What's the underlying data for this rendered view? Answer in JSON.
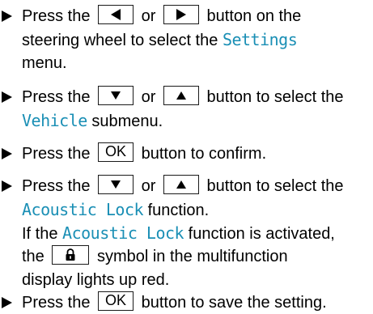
{
  "colors": {
    "text": "#000000",
    "display_text": "#1a8fb5"
  },
  "steps": [
    {
      "lines": [
        {
          "pre": "Press the",
          "key1": "left-arrow",
          "mid": "or",
          "key2": "right-arrow",
          "post": "button on the"
        },
        {
          "text": "steering wheel to select the",
          "display": "Settings"
        },
        {
          "text": "menu."
        }
      ]
    },
    {
      "lines": [
        {
          "pre": "Press the",
          "key1": "down-arrow",
          "mid": "or",
          "key2": "up-arrow",
          "post": "button to select the"
        },
        {
          "display": "Vehicle",
          "text": "submenu."
        }
      ]
    },
    {
      "lines": [
        {
          "pre": "Press the",
          "key": "OK",
          "post": "button to confirm."
        }
      ]
    },
    {
      "lines": [
        {
          "pre": "Press the",
          "key1": "down-arrow",
          "mid": "or",
          "key2": "up-arrow",
          "post": "button to select the"
        },
        {
          "display": "Acoustic Lock",
          "text": "function."
        },
        {
          "pre": "If the",
          "display": "Acoustic Lock",
          "post": "function is activated,"
        },
        {
          "pre": "the",
          "key": "lock-icon",
          "post": "symbol in the multifunction"
        },
        {
          "text": "display lights up red."
        }
      ]
    },
    {
      "lines": [
        {
          "pre": "Press the",
          "key": "OK",
          "post": "button to save the setting."
        }
      ]
    }
  ]
}
